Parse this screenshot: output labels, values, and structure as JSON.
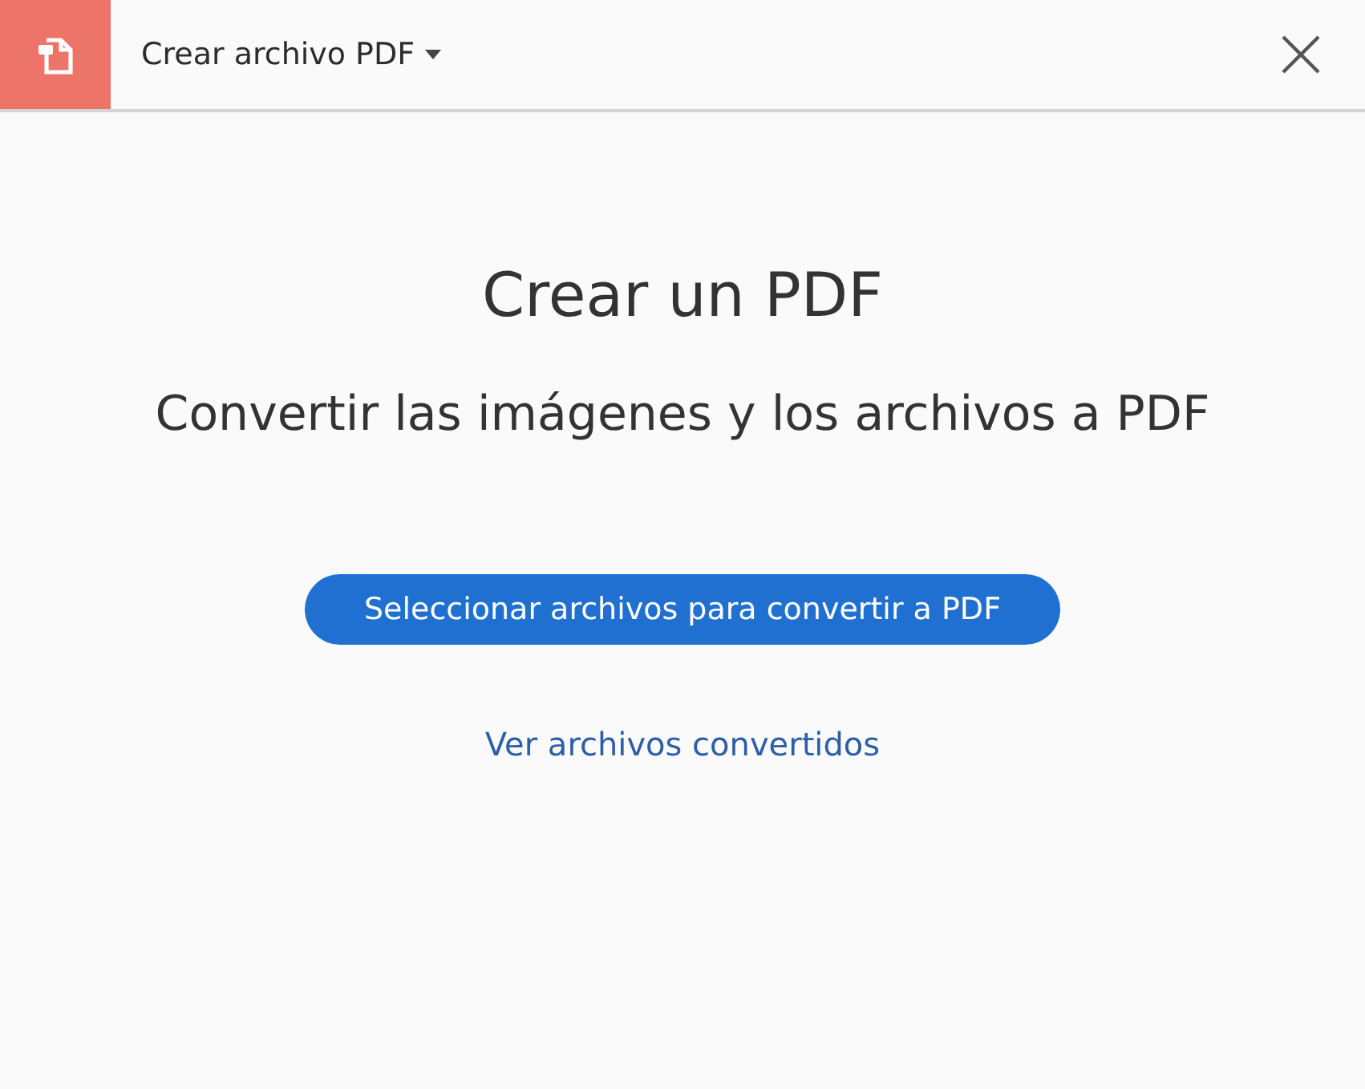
{
  "header": {
    "title": "Crear archivo PDF"
  },
  "main": {
    "heading": "Crear un PDF",
    "subheading": "Convertir las imágenes y los archivos a PDF",
    "button": "Seleccionar archivos para convertir a PDF",
    "link": "Ver archivos convertidos"
  }
}
